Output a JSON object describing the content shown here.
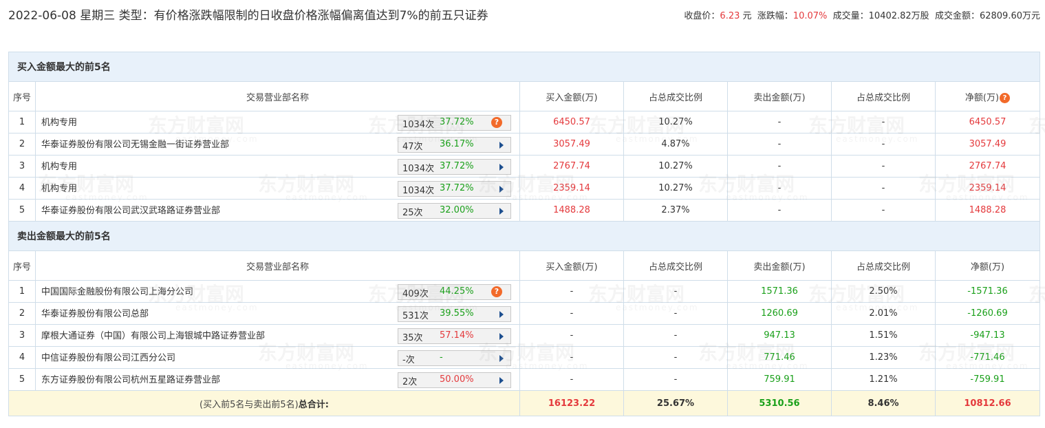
{
  "header": {
    "title": "2022-06-08 星期三 类型：有价格涨跌幅限制的日收盘价格涨幅偏离值达到7%的前五只证券",
    "close_label": "收盘价：",
    "close_value": "6.23",
    "close_unit": " 元",
    "change_label": "涨跌幅：",
    "change_value": "10.07%",
    "volume_label": "成交量：",
    "volume_value": "10402.82万股",
    "amount_label": "成交金额：",
    "amount_value": "62809.60万元"
  },
  "columns": {
    "index": "序号",
    "name": "交易营业部名称",
    "buy": "买入金额(万)",
    "buy_ratio": "占总成交比例",
    "sell": "卖出金额(万)",
    "sell_ratio": "占总成交比例",
    "net": "净额(万)"
  },
  "help_icon_glyph": "?",
  "buy_section": {
    "title": "买入金额最大的前5名",
    "rows": [
      {
        "idx": "1",
        "name": "机构专用",
        "count": "1034次",
        "pct": "37.72%",
        "buy": "6450.57",
        "buy_ratio": "10.27%",
        "sell": "-",
        "sell_ratio": "-",
        "net": "6450.57"
      },
      {
        "idx": "2",
        "name": "华泰证券股份有限公司无锡金融一街证券营业部",
        "count": "47次",
        "pct": "36.17%",
        "buy": "3057.49",
        "buy_ratio": "4.87%",
        "sell": "-",
        "sell_ratio": "-",
        "net": "3057.49"
      },
      {
        "idx": "3",
        "name": "机构专用",
        "count": "1034次",
        "pct": "37.72%",
        "buy": "2767.74",
        "buy_ratio": "10.27%",
        "sell": "-",
        "sell_ratio": "-",
        "net": "2767.74"
      },
      {
        "idx": "4",
        "name": "机构专用",
        "count": "1034次",
        "pct": "37.72%",
        "buy": "2359.14",
        "buy_ratio": "10.27%",
        "sell": "-",
        "sell_ratio": "-",
        "net": "2359.14"
      },
      {
        "idx": "5",
        "name": "华泰证券股份有限公司武汉武珞路证券营业部",
        "count": "25次",
        "pct": "32.00%",
        "buy": "1488.28",
        "buy_ratio": "2.37%",
        "sell": "-",
        "sell_ratio": "-",
        "net": "1488.28"
      }
    ]
  },
  "sell_section": {
    "title": "卖出金额最大的前5名",
    "rows": [
      {
        "idx": "1",
        "name": "中国国际金融股份有限公司上海分公司",
        "count": "409次",
        "pct": "44.25%",
        "buy": "-",
        "buy_ratio": "-",
        "sell": "1571.36",
        "sell_ratio": "2.50%",
        "net": "-1571.36"
      },
      {
        "idx": "2",
        "name": "华泰证券股份有限公司总部",
        "count": "531次",
        "pct": "39.55%",
        "buy": "-",
        "buy_ratio": "-",
        "sell": "1260.69",
        "sell_ratio": "2.01%",
        "net": "-1260.69"
      },
      {
        "idx": "3",
        "name": "摩根大通证券（中国）有限公司上海银城中路证券营业部",
        "count": "35次",
        "pct": "57.14%",
        "buy": "-",
        "buy_ratio": "-",
        "sell": "947.13",
        "sell_ratio": "1.51%",
        "net": "-947.13"
      },
      {
        "idx": "4",
        "name": "中信证券股份有限公司江西分公司",
        "count": "-次",
        "pct": "-",
        "buy": "-",
        "buy_ratio": "-",
        "sell": "771.46",
        "sell_ratio": "1.23%",
        "net": "-771.46"
      },
      {
        "idx": "5",
        "name": "东方证券股份有限公司杭州五星路证券营业部",
        "count": "2次",
        "pct": "50.00%",
        "buy": "-",
        "buy_ratio": "-",
        "sell": "759.91",
        "sell_ratio": "1.21%",
        "net": "-759.91"
      }
    ]
  },
  "total": {
    "label_prefix": "(买入前5名与卖出前5名)",
    "label_bold": "总合计:",
    "buy": "16123.22",
    "buy_ratio": "25.67%",
    "sell": "5310.56",
    "sell_ratio": "8.46%",
    "net": "10812.66"
  },
  "watermark": {
    "cn": "东方财富网",
    "en": "eastmoney.com"
  },
  "colors": {
    "up": "#e4393c",
    "down": "#1aa01a",
    "section_bg": "#e8f1fa",
    "total_bg": "#fdf8dc",
    "help_icon": "#f26a2a"
  }
}
